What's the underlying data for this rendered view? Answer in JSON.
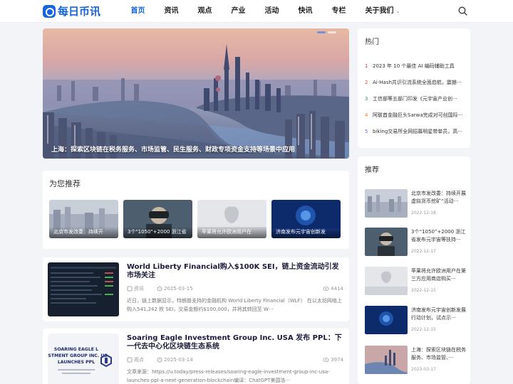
{
  "brand": {
    "name": "每日币讯",
    "accent": "#1565e0"
  },
  "nav": {
    "items": [
      "首页",
      "资讯",
      "观点",
      "产业",
      "活动",
      "快讯",
      "专栏",
      "关于我们"
    ],
    "active": "首页"
  },
  "hero": {
    "caption": "上海：探索区块链在税务服务、市场监管、民生服务、财政专项资金支持等场景中应用"
  },
  "recommend": {
    "title": "为您推荐",
    "cards": [
      {
        "label": "北京市发改委：持续开"
      },
      {
        "label": "3个\"1050\"+2000 浙江省"
      },
      {
        "label": "苹果将允许欧洲用户在"
      },
      {
        "label": "济南发布元宇宙创新发"
      }
    ]
  },
  "articles": [
    {
      "title": "World Liberty Financial购入$100K SEI，链上资金流动引发市场关注",
      "category": "资讯",
      "date": "2025-03-15",
      "views": "4414",
      "excerpt": "近日，链上数据显示，特朗普支持的金融机构 World Liberty Financial（WLF） 在以太坊网络上购入541,242 枚 SEI，交易金额约$100,000，并将其转回至 W···"
    },
    {
      "title": "Soaring Eagle Investment Group Inc. USA 发布 PPL：下一代去中心化区块链生态系统",
      "title_display": "Soaring Eagle Investment Group Inc. USA 发布 PPL：下一代去中心化区块链生态系统",
      "category": "观点",
      "date": "2025-03-14",
      "views": "3974",
      "excerpt": "文章来源：https://u.today/press-releases/soaring-eagle-investment-group-inc-usa-launches-ppl-a-next-generation-blockchain编译：ChatGPT美国洛···",
      "thumb_text": "SOARING EAGLE L\nESTMENT GROUP INC. US\nLAUNCHES PPL"
    }
  ],
  "hot": {
    "title": "热门",
    "items": [
      {
        "rank": "1",
        "text": "2023 年 10 个最佳 AI 编码辅助工具",
        "color": "#d23a8a"
      },
      {
        "rank": "2",
        "text": "Ai-Hash共识引流系统全面启航，震撼···",
        "color": "#e0484e"
      },
      {
        "rank": "3",
        "text": "工信部等五部门印发《元宇宙产业创···",
        "color": "#31a354"
      },
      {
        "rank": "4",
        "text": "阿联酋金融巨头Sarwa完成对可创国际···",
        "color": "#e8822b"
      },
      {
        "rank": "5",
        "text": "biking交易所全网招募明星带单员，高···",
        "color": "#7b5cd6"
      }
    ]
  },
  "side_recommend": {
    "title": "推荐",
    "items": [
      {
        "title": "北京市发改委：持续开展虚拟货币挖矿“活动···",
        "date": "2022-12-18"
      },
      {
        "title": "3个“1050”+2000 浙江省发布元宇宙等扶持···",
        "date": "2022-12-17"
      },
      {
        "title": "苹果将允许欧洲用户在第三方应用商店购买···",
        "date": "2022-12-15"
      },
      {
        "title": "济南发布元宇宙创新发展行动计划，试点示···",
        "date": "2022-12-15"
      },
      {
        "title": "上海：探索区块链在税务服务、市场监管、···",
        "date": "2023-03-17"
      }
    ]
  }
}
